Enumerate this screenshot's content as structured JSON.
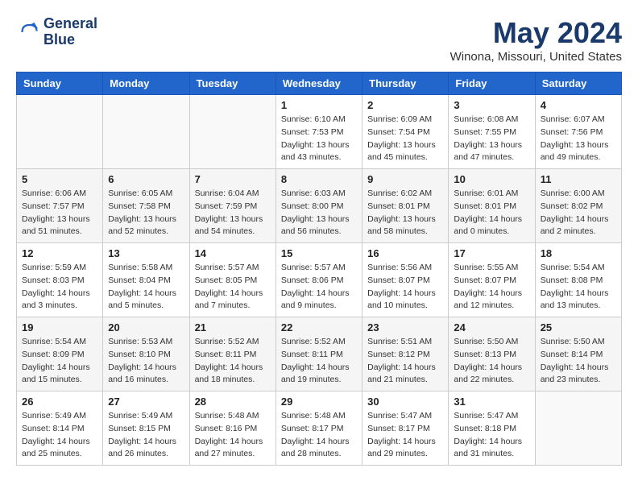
{
  "header": {
    "logo_line1": "General",
    "logo_line2": "Blue",
    "month": "May 2024",
    "location": "Winona, Missouri, United States"
  },
  "weekdays": [
    "Sunday",
    "Monday",
    "Tuesday",
    "Wednesday",
    "Thursday",
    "Friday",
    "Saturday"
  ],
  "weeks": [
    [
      {
        "day": "",
        "sunrise": "",
        "sunset": "",
        "daylight": ""
      },
      {
        "day": "",
        "sunrise": "",
        "sunset": "",
        "daylight": ""
      },
      {
        "day": "",
        "sunrise": "",
        "sunset": "",
        "daylight": ""
      },
      {
        "day": "1",
        "sunrise": "Sunrise: 6:10 AM",
        "sunset": "Sunset: 7:53 PM",
        "daylight": "Daylight: 13 hours and 43 minutes."
      },
      {
        "day": "2",
        "sunrise": "Sunrise: 6:09 AM",
        "sunset": "Sunset: 7:54 PM",
        "daylight": "Daylight: 13 hours and 45 minutes."
      },
      {
        "day": "3",
        "sunrise": "Sunrise: 6:08 AM",
        "sunset": "Sunset: 7:55 PM",
        "daylight": "Daylight: 13 hours and 47 minutes."
      },
      {
        "day": "4",
        "sunrise": "Sunrise: 6:07 AM",
        "sunset": "Sunset: 7:56 PM",
        "daylight": "Daylight: 13 hours and 49 minutes."
      }
    ],
    [
      {
        "day": "5",
        "sunrise": "Sunrise: 6:06 AM",
        "sunset": "Sunset: 7:57 PM",
        "daylight": "Daylight: 13 hours and 51 minutes."
      },
      {
        "day": "6",
        "sunrise": "Sunrise: 6:05 AM",
        "sunset": "Sunset: 7:58 PM",
        "daylight": "Daylight: 13 hours and 52 minutes."
      },
      {
        "day": "7",
        "sunrise": "Sunrise: 6:04 AM",
        "sunset": "Sunset: 7:59 PM",
        "daylight": "Daylight: 13 hours and 54 minutes."
      },
      {
        "day": "8",
        "sunrise": "Sunrise: 6:03 AM",
        "sunset": "Sunset: 8:00 PM",
        "daylight": "Daylight: 13 hours and 56 minutes."
      },
      {
        "day": "9",
        "sunrise": "Sunrise: 6:02 AM",
        "sunset": "Sunset: 8:01 PM",
        "daylight": "Daylight: 13 hours and 58 minutes."
      },
      {
        "day": "10",
        "sunrise": "Sunrise: 6:01 AM",
        "sunset": "Sunset: 8:01 PM",
        "daylight": "Daylight: 14 hours and 0 minutes."
      },
      {
        "day": "11",
        "sunrise": "Sunrise: 6:00 AM",
        "sunset": "Sunset: 8:02 PM",
        "daylight": "Daylight: 14 hours and 2 minutes."
      }
    ],
    [
      {
        "day": "12",
        "sunrise": "Sunrise: 5:59 AM",
        "sunset": "Sunset: 8:03 PM",
        "daylight": "Daylight: 14 hours and 3 minutes."
      },
      {
        "day": "13",
        "sunrise": "Sunrise: 5:58 AM",
        "sunset": "Sunset: 8:04 PM",
        "daylight": "Daylight: 14 hours and 5 minutes."
      },
      {
        "day": "14",
        "sunrise": "Sunrise: 5:57 AM",
        "sunset": "Sunset: 8:05 PM",
        "daylight": "Daylight: 14 hours and 7 minutes."
      },
      {
        "day": "15",
        "sunrise": "Sunrise: 5:57 AM",
        "sunset": "Sunset: 8:06 PM",
        "daylight": "Daylight: 14 hours and 9 minutes."
      },
      {
        "day": "16",
        "sunrise": "Sunrise: 5:56 AM",
        "sunset": "Sunset: 8:07 PM",
        "daylight": "Daylight: 14 hours and 10 minutes."
      },
      {
        "day": "17",
        "sunrise": "Sunrise: 5:55 AM",
        "sunset": "Sunset: 8:07 PM",
        "daylight": "Daylight: 14 hours and 12 minutes."
      },
      {
        "day": "18",
        "sunrise": "Sunrise: 5:54 AM",
        "sunset": "Sunset: 8:08 PM",
        "daylight": "Daylight: 14 hours and 13 minutes."
      }
    ],
    [
      {
        "day": "19",
        "sunrise": "Sunrise: 5:54 AM",
        "sunset": "Sunset: 8:09 PM",
        "daylight": "Daylight: 14 hours and 15 minutes."
      },
      {
        "day": "20",
        "sunrise": "Sunrise: 5:53 AM",
        "sunset": "Sunset: 8:10 PM",
        "daylight": "Daylight: 14 hours and 16 minutes."
      },
      {
        "day": "21",
        "sunrise": "Sunrise: 5:52 AM",
        "sunset": "Sunset: 8:11 PM",
        "daylight": "Daylight: 14 hours and 18 minutes."
      },
      {
        "day": "22",
        "sunrise": "Sunrise: 5:52 AM",
        "sunset": "Sunset: 8:11 PM",
        "daylight": "Daylight: 14 hours and 19 minutes."
      },
      {
        "day": "23",
        "sunrise": "Sunrise: 5:51 AM",
        "sunset": "Sunset: 8:12 PM",
        "daylight": "Daylight: 14 hours and 21 minutes."
      },
      {
        "day": "24",
        "sunrise": "Sunrise: 5:50 AM",
        "sunset": "Sunset: 8:13 PM",
        "daylight": "Daylight: 14 hours and 22 minutes."
      },
      {
        "day": "25",
        "sunrise": "Sunrise: 5:50 AM",
        "sunset": "Sunset: 8:14 PM",
        "daylight": "Daylight: 14 hours and 23 minutes."
      }
    ],
    [
      {
        "day": "26",
        "sunrise": "Sunrise: 5:49 AM",
        "sunset": "Sunset: 8:14 PM",
        "daylight": "Daylight: 14 hours and 25 minutes."
      },
      {
        "day": "27",
        "sunrise": "Sunrise: 5:49 AM",
        "sunset": "Sunset: 8:15 PM",
        "daylight": "Daylight: 14 hours and 26 minutes."
      },
      {
        "day": "28",
        "sunrise": "Sunrise: 5:48 AM",
        "sunset": "Sunset: 8:16 PM",
        "daylight": "Daylight: 14 hours and 27 minutes."
      },
      {
        "day": "29",
        "sunrise": "Sunrise: 5:48 AM",
        "sunset": "Sunset: 8:17 PM",
        "daylight": "Daylight: 14 hours and 28 minutes."
      },
      {
        "day": "30",
        "sunrise": "Sunrise: 5:47 AM",
        "sunset": "Sunset: 8:17 PM",
        "daylight": "Daylight: 14 hours and 29 minutes."
      },
      {
        "day": "31",
        "sunrise": "Sunrise: 5:47 AM",
        "sunset": "Sunset: 8:18 PM",
        "daylight": "Daylight: 14 hours and 31 minutes."
      },
      {
        "day": "",
        "sunrise": "",
        "sunset": "",
        "daylight": ""
      }
    ]
  ]
}
